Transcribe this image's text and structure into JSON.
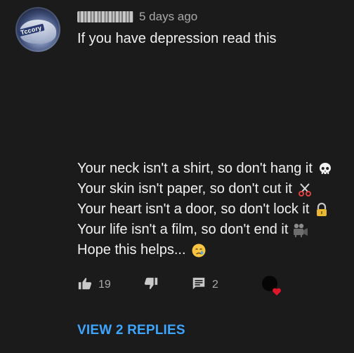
{
  "comment": {
    "time_ago": "5 days ago",
    "headline": "If you have depression read this",
    "avatar_badge": "Tccory",
    "lines": [
      {
        "text": "Your neck isn't a shirt, so don't hang it",
        "icon": "skull-icon"
      },
      {
        "text": "Your skin isn't paper, so don't cut it",
        "icon": "scissors-icon"
      },
      {
        "text": "Your heart isn't a door, so don't lock it",
        "icon": "lock-icon"
      },
      {
        "text": "Your life isn't a film, so don't end it",
        "icon": "movie-camera-icon"
      },
      {
        "text": "Hope this helps...",
        "icon": "crying-face-icon"
      }
    ]
  },
  "actions": {
    "like_count": "19",
    "reply_count": "2"
  },
  "view_replies_label": "VIEW 2 REPLIES",
  "colors": {
    "background": "#1b1b1b",
    "text": "#f1f1f1",
    "muted": "#aaaaaa",
    "link": "#3ea6ff",
    "heart": "#e0162b"
  }
}
